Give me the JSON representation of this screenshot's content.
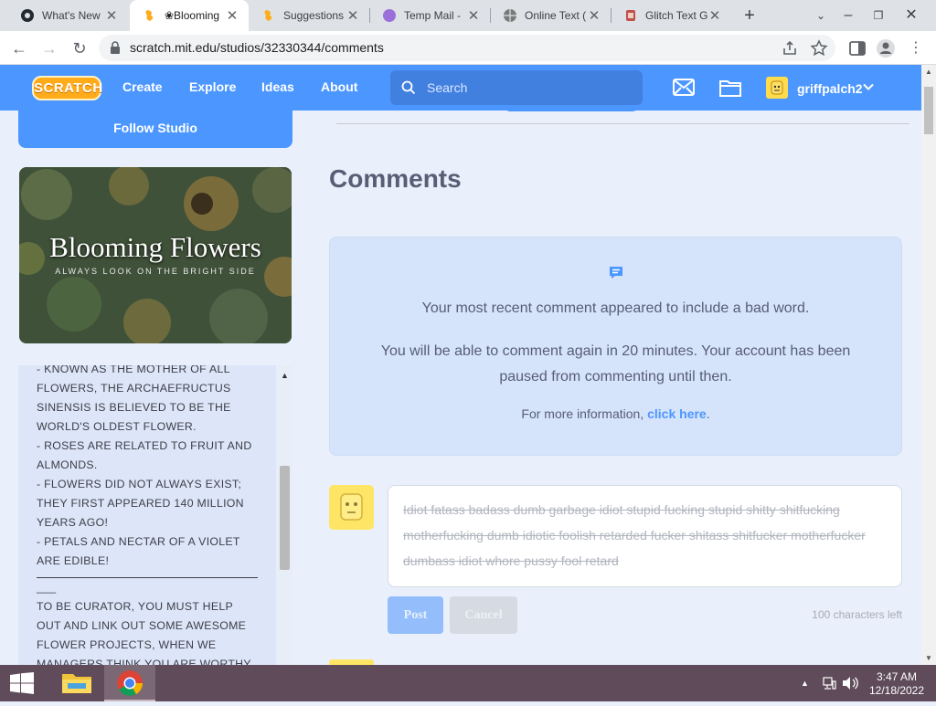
{
  "browser": {
    "tabs": [
      {
        "title": "What's New",
        "icon": "github-icon",
        "active": false
      },
      {
        "title": "❀Blooming",
        "icon": "scratch-icon",
        "active": true
      },
      {
        "title": "Suggestions",
        "icon": "scratch-icon",
        "active": false
      },
      {
        "title": "Temp Mail -",
        "icon": "tempmail-icon",
        "active": false
      },
      {
        "title": "Online Text (",
        "icon": "globe-icon",
        "active": false
      },
      {
        "title": "Glitch Text G",
        "icon": "glitch-icon",
        "active": false
      }
    ],
    "new_tab": "+",
    "url": "scratch.mit.edu/studios/32330344/comments"
  },
  "nav": {
    "logo": "SCRATCH",
    "links": [
      "Create",
      "Explore",
      "Ideas",
      "About"
    ],
    "search_placeholder": "Search",
    "username": "griffpalch2"
  },
  "studio": {
    "follow_label": "Follow Studio",
    "thumbnail_title": "Blooming Flowers",
    "thumbnail_subtitle": "ALWAYS LOOK ON THE BRIGHT SIDE",
    "description": [
      "- KNOWN AS THE MOTHER OF ALL FLOWERS, THE ARCHAEFRUCTUS SINENSIS IS BELIEVED TO BE THE WORLD'S OLDEST FLOWER.",
      "- ROSES ARE RELATED TO FRUIT AND ALMONDS.",
      "- FLOWERS DID NOT ALWAYS EXIST; THEY FIRST APPEARED 140 MILLION YEARS AGO!",
      "- PETALS AND NECTAR OF A VIOLET ARE EDIBLE!"
    ],
    "description_after": [
      "___",
      "TO BE CURATOR, YOU MUST HELP OUT AND LINK OUT SOME AWESOME FLOWER PROJECTS, WHEN WE MANAGERS THINK YOU ARE WORTHY"
    ]
  },
  "comments": {
    "heading": "Comments",
    "notice_line1": "Your most recent comment appeared to include a bad word.",
    "notice_line2": "You will be able to comment again in 20 minutes. Your account has been paused from commenting until then.",
    "notice_line3_prefix": "For more information, ",
    "notice_link": "click here",
    "notice_line3_suffix": ".",
    "textarea_value": "Idiot fatass badass dumb garbage idiot stupid fucking stupid shitty shitfucking motherfucking dumb idiotic foolish retarded fucker shitass shitfucker motherfucker dumbass idiot whore pussy fool retard",
    "post_label": "Post",
    "cancel_label": "Cancel",
    "chars_left": "100 characters left"
  },
  "taskbar": {
    "time": "3:47 AM",
    "date": "12/18/2022"
  },
  "colors": {
    "scratch_blue": "#4c97ff",
    "notice_bg": "#d5e3fb",
    "heading": "#575e75",
    "taskbar": "#5f4b59"
  }
}
